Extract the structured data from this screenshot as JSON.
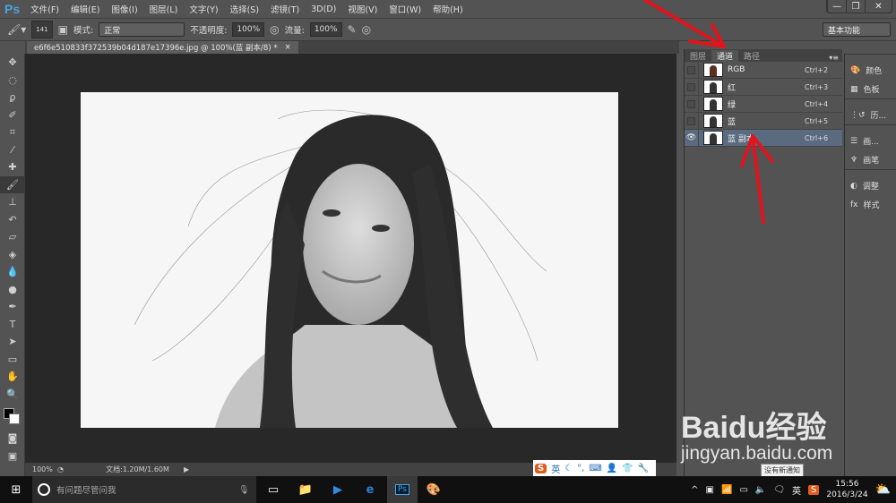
{
  "app": {
    "logo": "Ps"
  },
  "menu": [
    "文件(F)",
    "编辑(E)",
    "图像(I)",
    "图层(L)",
    "文字(Y)",
    "选择(S)",
    "滤镜(T)",
    "3D(D)",
    "视图(V)",
    "窗口(W)",
    "帮助(H)"
  ],
  "window_controls": {
    "minimize": "—",
    "restore": "❐",
    "close": "✕"
  },
  "options": {
    "brush_size": "141",
    "mode_label": "模式:",
    "mode_value": "正常",
    "opacity_label": "不透明度:",
    "opacity_value": "100%",
    "flow_label": "流量:",
    "flow_value": "100%",
    "workspace": "基本功能"
  },
  "document": {
    "tab_title": "e6f6e510833f372539b04d187e17396e.jpg @ 100%(蓝 副本/8) *",
    "close": "×"
  },
  "status": {
    "zoom": "100%",
    "doc_info": "文档:1.20M/1.60M"
  },
  "panel": {
    "tabs": [
      "图层",
      "通道",
      "路径"
    ],
    "active_tab": 1,
    "channels": [
      {
        "name": "RGB",
        "shortcut": "Ctrl+2",
        "visible": false
      },
      {
        "name": "红",
        "shortcut": "Ctrl+3",
        "visible": false
      },
      {
        "name": "绿",
        "shortcut": "Ctrl+4",
        "visible": false
      },
      {
        "name": "蓝",
        "shortcut": "Ctrl+5",
        "visible": false
      },
      {
        "name": "蓝 副本",
        "shortcut": "Ctrl+6",
        "visible": true,
        "selected": true
      }
    ]
  },
  "right_panel": [
    "颜色",
    "色板",
    "历...",
    "画...",
    "画笔",
    "调整",
    "样式"
  ],
  "ime": {
    "lang": "英"
  },
  "taskbar": {
    "search_placeholder": "有问题尽管问我",
    "tray_lang": "英",
    "time": "15:56",
    "date": "2016/3/24",
    "tooltip": "没有新通知"
  },
  "watermark": {
    "brand": "Baidu经验",
    "url": "jingyan.baidu.com"
  },
  "colors": {
    "accent": "#4aa3e0",
    "selected_row": "#5a6b80",
    "annotation": "#e0141c"
  }
}
